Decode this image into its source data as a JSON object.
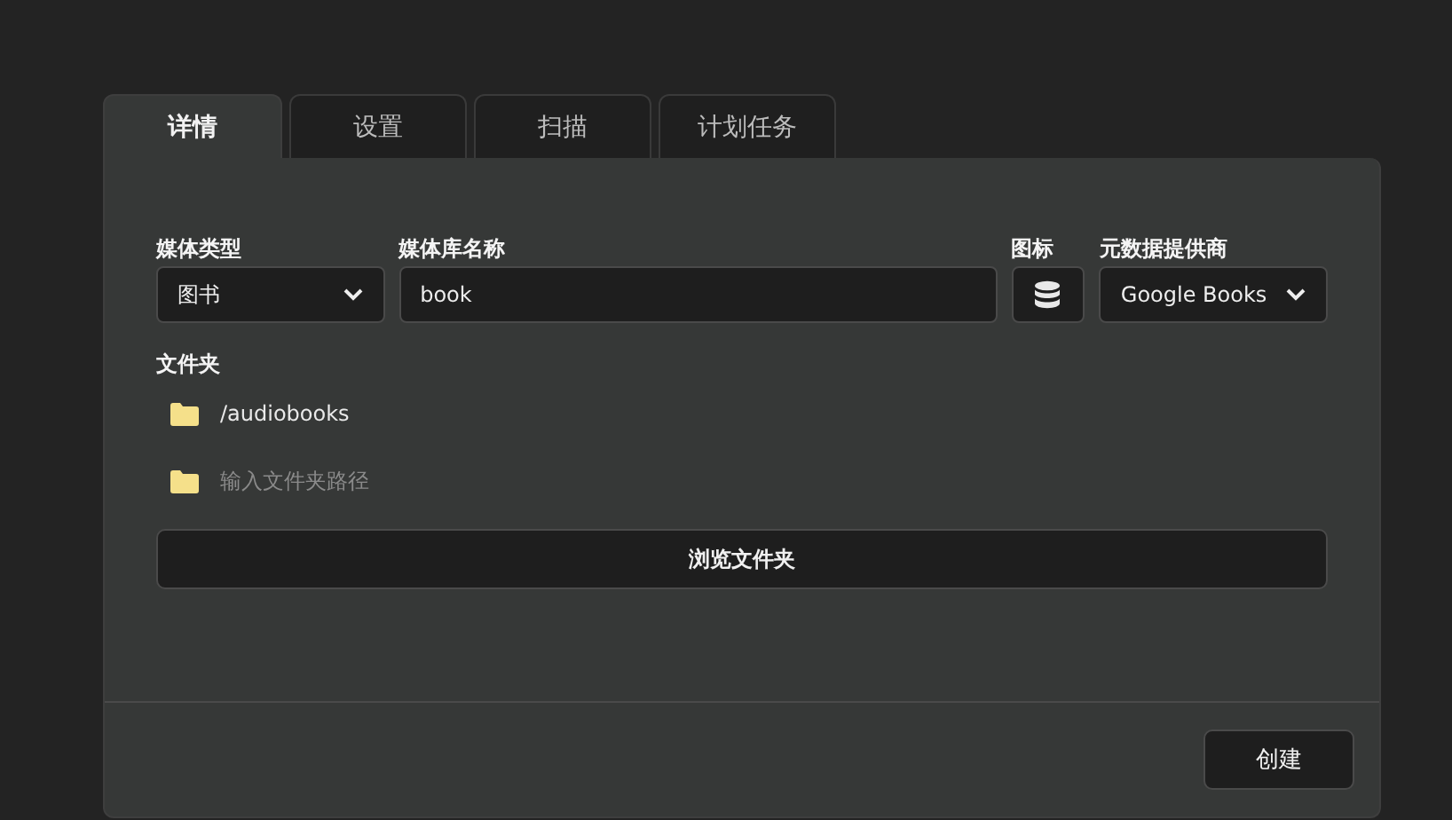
{
  "tabs": [
    {
      "label": "详情",
      "selected": true
    },
    {
      "label": "设置",
      "selected": false
    },
    {
      "label": "扫描",
      "selected": false
    },
    {
      "label": "计划任务",
      "selected": false
    }
  ],
  "fields": {
    "media_type": {
      "label": "媒体类型",
      "value": "图书"
    },
    "library_name": {
      "label": "媒体库名称",
      "value": "book"
    },
    "icon": {
      "label": "图标"
    },
    "metadata_provider": {
      "label": "元数据提供商",
      "value": "Google Books"
    }
  },
  "folders": {
    "label": "文件夹",
    "items": [
      {
        "path": "/audiobooks"
      }
    ],
    "new_folder": {
      "placeholder": "输入文件夹路径"
    }
  },
  "browse_button": "浏览文件夹",
  "create_button": "创建"
}
